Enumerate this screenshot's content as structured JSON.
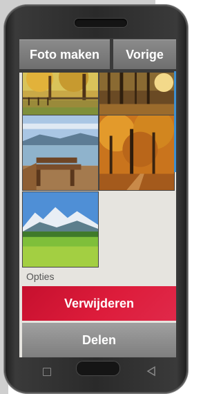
{
  "toolbar": {
    "take_photo_label": "Foto maken",
    "previous_label": "Vorige"
  },
  "gallery": {
    "thumbnails": [
      {
        "name": "autumn-park-photo"
      },
      {
        "name": "forest-sunbeams-photo"
      },
      {
        "name": "lake-bench-photo"
      },
      {
        "name": "autumn-forest-photo"
      },
      {
        "name": "alpine-meadow-photo"
      }
    ]
  },
  "options": {
    "heading": "Opties",
    "delete_label": "Verwijderen",
    "share_label": "Delen"
  },
  "colors": {
    "delete": "#d8163a",
    "button_gray": "#7e7e7e",
    "scroll_indicator": "#3d8fd1"
  },
  "nav": {
    "recent_icon": "square-icon",
    "home_icon": "home-button",
    "back_icon": "back-triangle-icon"
  }
}
